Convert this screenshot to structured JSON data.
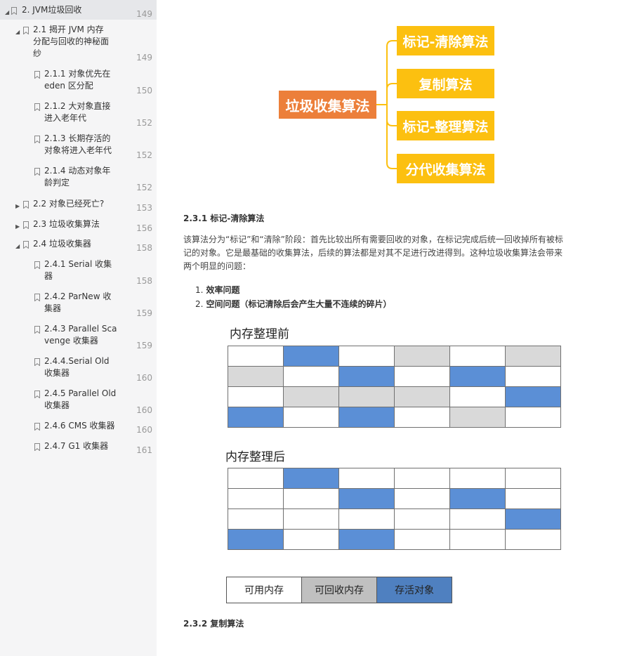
{
  "toc": [
    {
      "label": "2. JVM垃圾回收",
      "page": "149",
      "expanded": true
    },
    {
      "label": "2.1  揭开 JVM 内存分配与回收的神秘面纱",
      "lines": [
        "2.1  揭开 JVM 内存",
        "分配与回收的神秘面",
        "纱"
      ],
      "page": "149",
      "expanded": true
    },
    {
      "lines": [
        "2.1.1 对象优先在",
        "eden 区分配"
      ],
      "page": "150"
    },
    {
      "lines": [
        "2.1.2 大对象直接",
        "进入老年代"
      ],
      "page": "152"
    },
    {
      "lines": [
        "2.1.3 长期存活的",
        "对象将进入老年代"
      ],
      "page": "152"
    },
    {
      "lines": [
        "2.1.4 动态对象年",
        "龄判定"
      ],
      "page": "152"
    },
    {
      "label": "2.2 对象已经死亡?",
      "page": "153",
      "expanded": false
    },
    {
      "label": "2.3 垃圾收集算法",
      "page": "156",
      "expanded": false
    },
    {
      "label": "2.4 垃圾收集器",
      "page": "158",
      "expanded": true
    },
    {
      "lines": [
        "2.4.1 Serial 收集",
        "器"
      ],
      "page": "158"
    },
    {
      "lines": [
        "2.4.2 ParNew 收",
        "集器"
      ],
      "page": "159"
    },
    {
      "lines": [
        "2.4.3 Parallel Sca",
        "venge 收集器"
      ],
      "page": "159"
    },
    {
      "lines": [
        "2.4.4.Serial Old",
        "收集器"
      ],
      "page": "160"
    },
    {
      "lines": [
        "2.4.5 Parallel Old",
        "收集器"
      ],
      "page": "160"
    },
    {
      "label": "2.4.6 CMS 收集器",
      "page": "160"
    },
    {
      "label": "2.4.7 G1 收集器",
      "page": "161"
    }
  ],
  "mindmap": {
    "root": "垃圾收集算法",
    "leaves": [
      "标记-清除算法",
      "复制算法",
      "标记-整理算法",
      "分代收集算法"
    ],
    "root_color": "#ec7f3a",
    "leaf_color": "#fcc010",
    "line_color": "#fcc010"
  },
  "section": {
    "heading": "2.3.1 标记-清除算法",
    "para_lines": [
      "该算法分为“标记”和“清除”阶段：首先比较出所有需要回收的对象，在标记完成后统一回收掉所有被标",
      "记的对象。它是最基础的收集算法，后续的算法都是对其不足进行改进得到。这种垃圾收集算法会带来",
      "两个明显的问题："
    ],
    "list": [
      {
        "num": "1.",
        "text": "效率问题"
      },
      {
        "num": "2.",
        "text": "空间问题（标记清除后会产生大量不连续的碎片）"
      }
    ]
  },
  "figure": {
    "before_title": "内存整理前",
    "after_title": "内存整理后",
    "before_grid": [
      [
        "free",
        "live",
        "free",
        "rec",
        "free",
        "rec"
      ],
      [
        "rec",
        "free",
        "live",
        "free",
        "live",
        "free"
      ],
      [
        "free",
        "rec",
        "rec",
        "rec",
        "free",
        "live"
      ],
      [
        "live",
        "free",
        "live",
        "free",
        "rec",
        "free"
      ]
    ],
    "after_grid": [
      [
        "free",
        "live",
        "free",
        "free",
        "free",
        "free"
      ],
      [
        "free",
        "free",
        "live",
        "free",
        "live",
        "free"
      ],
      [
        "free",
        "free",
        "free",
        "free",
        "free",
        "live"
      ],
      [
        "live",
        "free",
        "live",
        "free",
        "free",
        "free"
      ]
    ],
    "legend": [
      {
        "label": "可用内存",
        "kind": "free",
        "color": "#ffffff"
      },
      {
        "label": "可回收内存",
        "kind": "rec",
        "color": "#c0c0c0"
      },
      {
        "label": "存活对象",
        "kind": "live",
        "color": "#4f80c0"
      }
    ]
  },
  "next_heading": "2.3.2 复制算法"
}
